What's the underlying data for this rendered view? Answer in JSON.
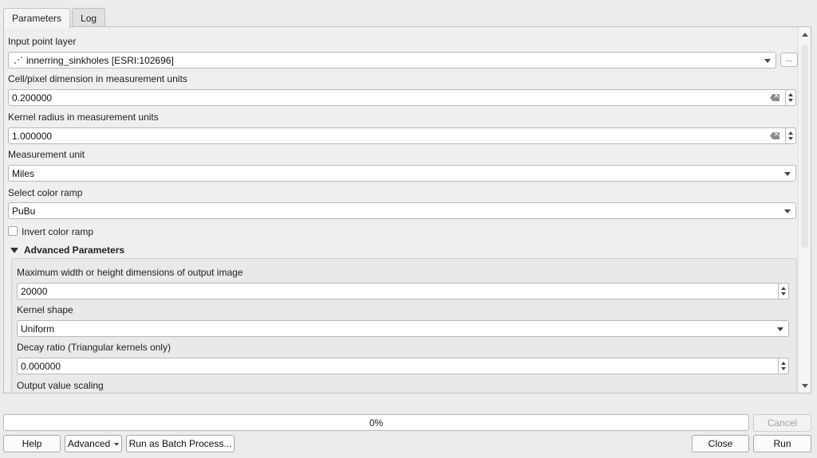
{
  "tabs": [
    {
      "label": "Parameters",
      "active": true
    },
    {
      "label": "Log",
      "active": false
    }
  ],
  "params": {
    "input_layer": {
      "label": "Input point layer",
      "value": "innerring_sinkholes [ESRI:102696]",
      "browse_label": "...",
      "icon": "point-layer-icon"
    },
    "cell_size": {
      "label": "Cell/pixel dimension in measurement units",
      "value": "0.200000"
    },
    "kernel_radius": {
      "label": "Kernel radius in measurement units",
      "value": "1.000000"
    },
    "measurement_unit": {
      "label": "Measurement unit",
      "value": "Miles"
    },
    "color_ramp": {
      "label": "Select color ramp",
      "value": "PuBu"
    },
    "invert": {
      "label": "Invert color ramp",
      "checked": false
    }
  },
  "advanced": {
    "title": "Advanced Parameters",
    "expanded": true,
    "max_dim": {
      "label": "Maximum width or height dimensions of output image",
      "value": "20000"
    },
    "kernel_shape": {
      "label": "Kernel shape",
      "value": "Uniform"
    },
    "decay": {
      "label": "Decay ratio (Triangular kernels only)",
      "value": "0.000000"
    },
    "output_scaling": {
      "label": "Output value scaling"
    }
  },
  "progress": {
    "value": 0,
    "text": "0%"
  },
  "buttons": {
    "cancel": "Cancel",
    "help": "Help",
    "advanced": "Advanced",
    "batch": "Run as Batch Process...",
    "close": "Close",
    "run": "Run"
  },
  "colors": {
    "accent": "#5a9cf0",
    "background": "#ececec"
  }
}
